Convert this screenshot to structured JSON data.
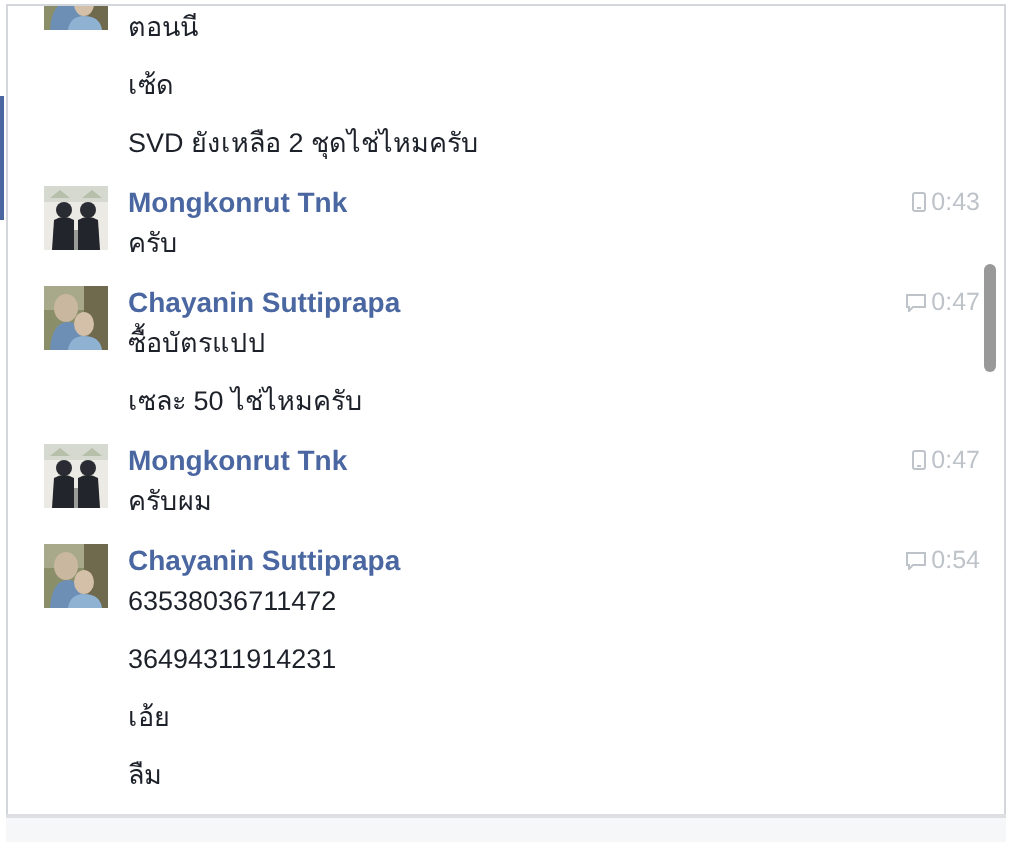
{
  "messages": [
    {
      "messages": [
        "ตอนนี",
        "เซ้ด",
        "SVD ยังเหลือ 2 ชุดไช่ไหมครับ"
      ]
    },
    {
      "sender": "Mongkonrut Tnk",
      "kind": "mobile",
      "time": "0:43",
      "messages": [
        "ครับ"
      ]
    },
    {
      "sender": "Chayanin Suttiprapa",
      "kind": "web",
      "time": "0:47",
      "messages": [
        "ซื้อบัตรแปป",
        "เซละ 50 ไช่ไหมครับ"
      ]
    },
    {
      "sender": "Mongkonrut Tnk",
      "kind": "mobile",
      "time": "0:47",
      "messages": [
        "ครับผม"
      ]
    },
    {
      "sender": "Chayanin Suttiprapa",
      "kind": "web",
      "time": "0:54",
      "messages": [
        "63538036711472",
        "36494311914231",
        "เอ้ย",
        "ลืม"
      ]
    }
  ]
}
